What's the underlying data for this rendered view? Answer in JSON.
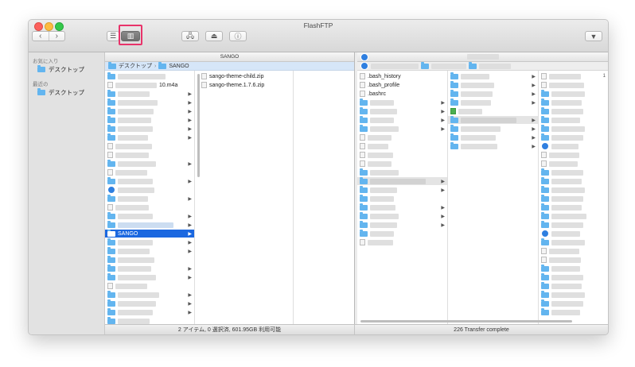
{
  "window": {
    "title": "FlashFTP"
  },
  "toolbar": {
    "back_glyph": "‹",
    "forward_glyph": "›",
    "view_list_glyph": "☰",
    "view_column_glyph": "▥",
    "connect_glyph": "🖧",
    "eject_glyph": "⏏",
    "info_glyph": "ⓘ",
    "menu_glyph": "▼"
  },
  "sidebar": {
    "favorites_label": "お気に入り",
    "favorites": [
      {
        "label": "デスクトップ",
        "icon": "folder-icon"
      }
    ],
    "recent_label": "最近の",
    "recent": [
      {
        "label": "デスクトップ",
        "icon": "folder-icon"
      }
    ]
  },
  "local": {
    "header": "SANGO",
    "path": [
      "デスクトップ",
      "SANGO"
    ],
    "path_separator": "›",
    "col1_visible_name": "10.m4a",
    "col1_selected": "SANGO",
    "col2_files": [
      "sango-theme-child.zip",
      "sango-theme.1.7.6.zip"
    ],
    "status": "2 アイテム, 0 選択済, 601.95GB 利用可能"
  },
  "remote": {
    "col1_files": [
      ".bash_history",
      ".bash_profile",
      ".bashrc"
    ],
    "col3_visible_char": "1",
    "status": "226 Transfer complete"
  },
  "colors": {
    "accent": "#1b68e0",
    "folder": "#63b5ef",
    "highlight": "#e8336a",
    "path_bar": "#d6e6f8"
  }
}
